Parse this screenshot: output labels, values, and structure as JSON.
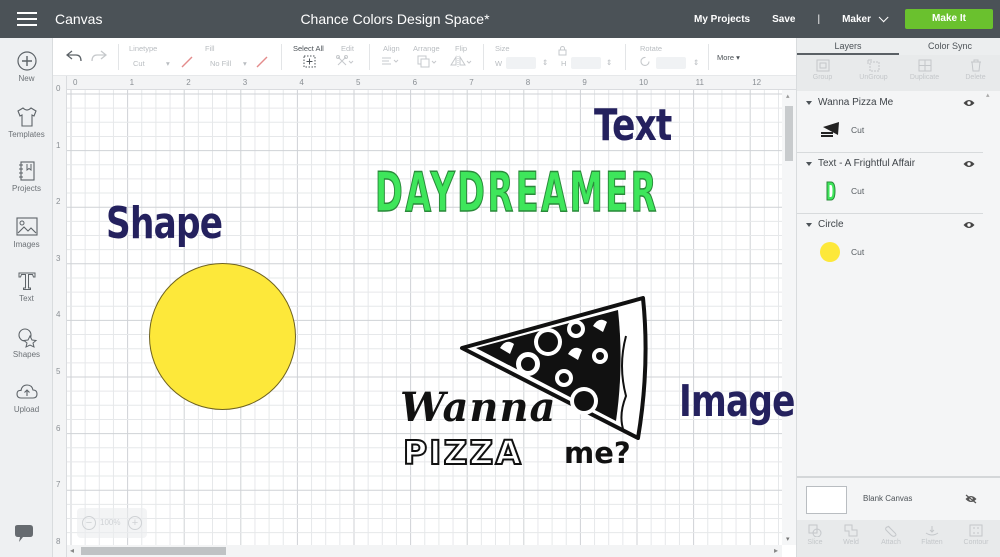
{
  "header": {
    "section": "Canvas",
    "title": "Chance Colors Design Space*",
    "my_projects": "My Projects",
    "save": "Save",
    "separator": "|",
    "machine": "Maker",
    "make_it": "Make It",
    "make_it_color": "#6ac12e"
  },
  "sidebar": {
    "items": [
      {
        "label": "New",
        "icon": "plus-circle-icon"
      },
      {
        "label": "Templates",
        "icon": "tshirt-icon"
      },
      {
        "label": "Projects",
        "icon": "notebook-icon"
      },
      {
        "label": "Images",
        "icon": "image-icon"
      },
      {
        "label": "Text",
        "icon": "text-icon"
      },
      {
        "label": "Shapes",
        "icon": "shapes-icon"
      },
      {
        "label": "Upload",
        "icon": "upload-cloud-icon"
      }
    ],
    "chat_icon": "chat-bubble-icon"
  },
  "toolbar": {
    "linetype_label": "Linetype",
    "linetype_value": "Cut",
    "fill_label": "Fill",
    "fill_value": "No Fill",
    "select_all": "Select All",
    "edit": "Edit",
    "align": "Align",
    "arrange": "Arrange",
    "flip": "Flip",
    "size": "Size",
    "w": "W",
    "h": "H",
    "rotate": "Rotate",
    "more": "More ▾"
  },
  "canvas": {
    "ruler_top": [
      "0",
      "1",
      "2",
      "3",
      "4",
      "5",
      "6",
      "7",
      "8",
      "9",
      "10",
      "11",
      "12"
    ],
    "ruler_left": [
      "0",
      "1",
      "2",
      "3",
      "4",
      "5",
      "6",
      "7",
      "8"
    ],
    "labels": {
      "shape": "Shape",
      "text": "Text",
      "image": "Image"
    },
    "text_object": "DAYDREAMER",
    "text_color": "#3ee65b",
    "circle_color": "#fde83a",
    "image_text": {
      "line1": "Wanna",
      "line2": "PIZZA",
      "line3": "me?"
    },
    "label_color": "#24215e",
    "zoom": "100%"
  },
  "panel": {
    "tabs": [
      "Layers",
      "Color Sync"
    ],
    "active_tab": "Layers",
    "actions": [
      "Group",
      "UnGroup",
      "Duplicate",
      "Delete"
    ],
    "layers": [
      {
        "name": "Wanna Pizza Me",
        "operation": "Cut"
      },
      {
        "name": "Text - A Frightful Affair",
        "operation": "Cut"
      },
      {
        "name": "Circle",
        "operation": "Cut"
      }
    ],
    "blank_canvas": "Blank Canvas",
    "bottom_actions": [
      "Slice",
      "Weld",
      "Attach",
      "Flatten",
      "Contour"
    ]
  }
}
